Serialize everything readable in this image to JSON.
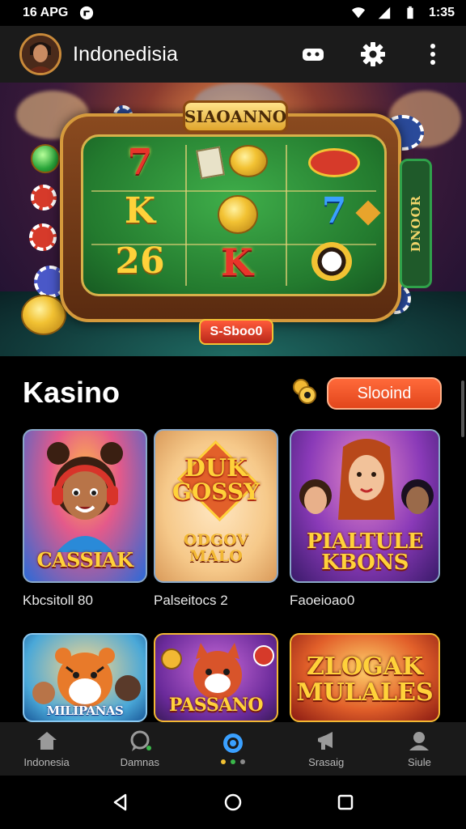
{
  "status_bar": {
    "left_text": "16 APG",
    "time": "1:35",
    "icons": [
      "app-notification-icon",
      "wifi-icon",
      "signal-icon",
      "battery-icon"
    ]
  },
  "header": {
    "title": "Indonedisia",
    "actions": [
      "gamepad-icon",
      "gear-icon",
      "more-vertical-icon"
    ]
  },
  "banner": {
    "sign_text": "SIAOANNO",
    "side_text": "DNOOR",
    "bet_text": "S-Sboo0",
    "symbols": [
      "7",
      "K",
      "26",
      "K",
      "7"
    ]
  },
  "section": {
    "title": "Kasino",
    "button_label": "Slooind"
  },
  "games": [
    {
      "title": "CASSIAK",
      "label_text": "Kbcsitoll",
      "label_num": "80"
    },
    {
      "title_line1": "DUK",
      "title_line2": "GOSSY",
      "subtitle_line1": "ODGOV",
      "subtitle_line2": "MALO",
      "label_text": "Palseitocs",
      "label_num": "2"
    },
    {
      "title_line1": "PIALTULE",
      "title_line2": "KBONS",
      "label_text": "Faoeioao0",
      "label_num": ""
    },
    {
      "title": "MILIPANAS"
    },
    {
      "title": "PASSANO"
    },
    {
      "title_line1": "ZLOGAK",
      "title_line2": "MULALES"
    }
  ],
  "bottom_nav": [
    {
      "label": "Indonesia",
      "icon": "home-icon"
    },
    {
      "label": "Damnas",
      "icon": "chat-icon"
    },
    {
      "label": "",
      "icon": "center-circle-icon"
    },
    {
      "label": "Srasaig",
      "icon": "megaphone-icon"
    },
    {
      "label": "Siule",
      "icon": "profile-icon"
    }
  ],
  "colors": {
    "accent": "#e2461c",
    "header_bg": "#1b1b1b",
    "nav_bg": "#1a1a1a",
    "felt": "#237a2e"
  }
}
